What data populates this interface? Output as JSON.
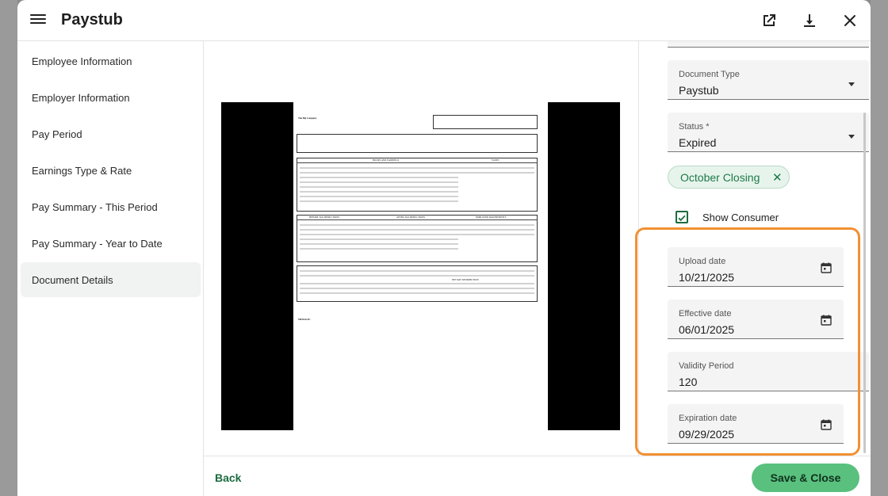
{
  "header": {
    "title": "Paystub"
  },
  "sidebar": {
    "items": [
      {
        "label": "Employee Information"
      },
      {
        "label": "Employer Information"
      },
      {
        "label": "Pay Period"
      },
      {
        "label": "Earnings Type & Rate"
      },
      {
        "label": "Pay Summary - This Period"
      },
      {
        "label": "Pay Summary - Year to Date"
      },
      {
        "label": "Document Details"
      }
    ],
    "active_index": 6
  },
  "form": {
    "document_type": {
      "label": "Document Type",
      "value": "Paystub"
    },
    "status": {
      "label": "Status *",
      "value": "Expired"
    },
    "tag_chip": "October Closing",
    "show_consumer": {
      "label": "Show Consumer",
      "checked": true
    },
    "upload_date": {
      "label": "Upload date",
      "value": "10/21/2025"
    },
    "effective_date": {
      "label": "Effective date",
      "value": "06/01/2025"
    },
    "validity_period": {
      "label": "Validity Period",
      "value": "120"
    },
    "expiration_date": {
      "label": "Expiration date",
      "value": "09/29/2025"
    }
  },
  "footer": {
    "back_label": "Back",
    "save_label": "Save & Close"
  },
  "icons": {
    "menu": "hamburger-menu-icon",
    "open_external": "open-in-new-icon",
    "download": "download-icon",
    "close": "close-icon",
    "calendar": "calendar-icon",
    "chip_remove": "close-icon",
    "checkbox": "check-icon"
  },
  "colors": {
    "accent": "#1b6b3f",
    "save_button": "#59c07e",
    "chip_bg": "#e7f4ec",
    "highlight": "#f29032"
  },
  "document_preview": {
    "company": "The Big Company",
    "section_headers": [
      "HOURS AND EARNINGS",
      "TAXES",
      "BEFORE TAX DEDUCTIONS",
      "AFTER TAX DEDUCTIONS",
      "EMPLOYER PAID BENEFITS",
      "NET PAY DISTRIBUTION"
    ],
    "note": "MESSAGE:"
  }
}
